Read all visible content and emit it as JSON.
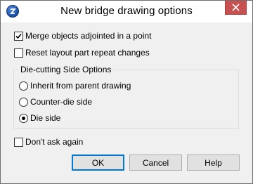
{
  "window": {
    "title": "New bridge drawing options"
  },
  "options": {
    "merge_objects": {
      "label": "Merge objects adjointed in a point",
      "checked": true
    },
    "reset_layout": {
      "label": "Reset layout part repeat changes",
      "checked": false
    }
  },
  "die_cutting": {
    "group_label": "Die-cutting Side Options",
    "choices": [
      {
        "label": "Inherit from parent drawing",
        "selected": false
      },
      {
        "label": "Counter-die side",
        "selected": false
      },
      {
        "label": "Die side",
        "selected": true
      }
    ]
  },
  "dont_ask": {
    "label": "Don't ask again",
    "checked": false
  },
  "buttons": {
    "ok": "OK",
    "cancel": "Cancel",
    "help": "Help"
  },
  "colors": {
    "close_button": "#c75050",
    "default_button_border": "#0078d7",
    "app_icon": "#1b4fa6"
  },
  "icons": {
    "app": "app-logo-icon",
    "close": "close-icon",
    "check": "checkmark-icon"
  }
}
